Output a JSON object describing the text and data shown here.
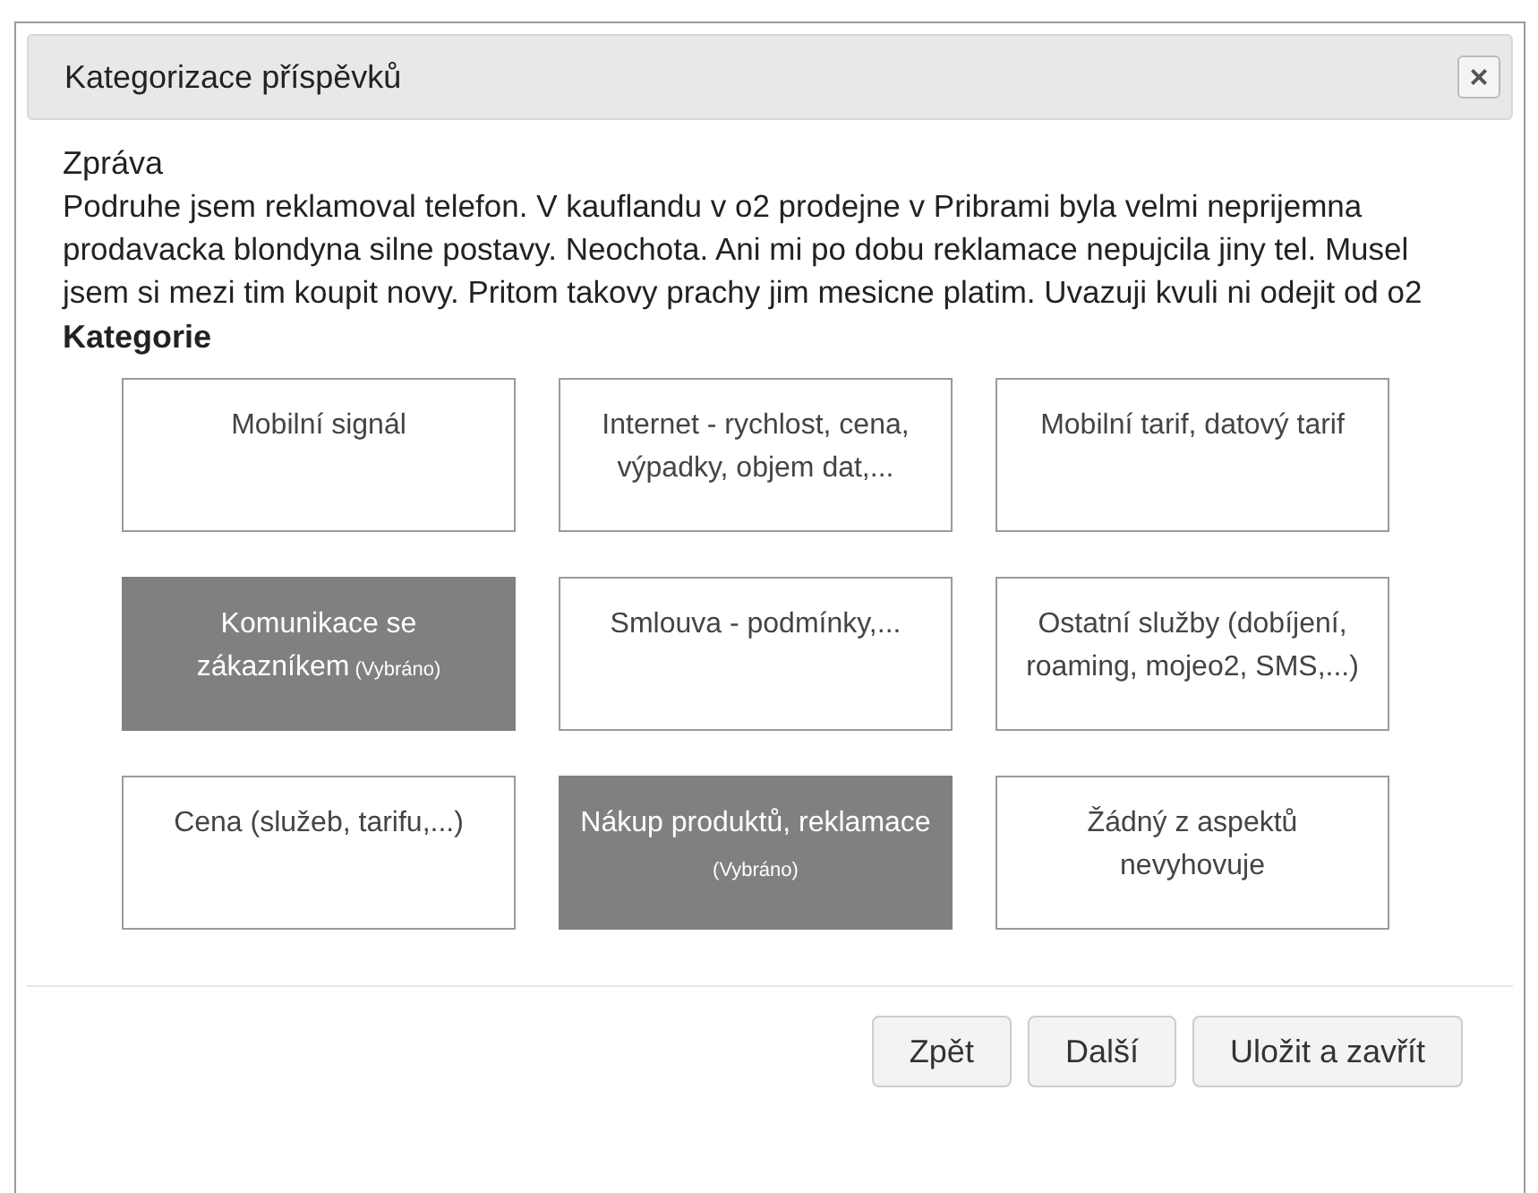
{
  "dialog": {
    "title": "Kategorizace příspěvků",
    "close_label": "×"
  },
  "message": {
    "heading": "Zpráva",
    "text": "Podruhe jsem reklamoval telefon. V kauflandu v o2 prodejne v Pribrami byla velmi neprijemna prodavacka blondyna silne postavy. Neochota. Ani mi po dobu reklamace nepujcila jiny tel. Musel jsem si mezi tim koupit novy. Pritom takovy prachy jim mesicne platim. Uvazuji kvuli ni odejit od o2"
  },
  "categories": {
    "heading": "Kategorie",
    "items": [
      {
        "label": "Mobilní signál",
        "selected": false
      },
      {
        "label": "Internet - rychlost, cena, výpadky, objem dat,...",
        "selected": false
      },
      {
        "label": "Mobilní tarif, datový tarif",
        "selected": false
      },
      {
        "label": "Komunikace se zákazníkem",
        "selected": true,
        "note": "(Vybráno)"
      },
      {
        "label": "Smlouva - podmínky,...",
        "selected": false
      },
      {
        "label": "Ostatní služby (dobíjení, roaming, mojeo2, SMS,...)",
        "selected": false
      },
      {
        "label": "Cena (služeb, tarifu,...)",
        "selected": false
      },
      {
        "label": "Nákup produktů, reklamace",
        "selected": true,
        "note": "(Vybráno)"
      },
      {
        "label": "Žádný z aspektů nevyhovuje",
        "selected": false
      }
    ]
  },
  "buttons": [
    "Zpět",
    "Další",
    "Uložit a zavřít"
  ]
}
